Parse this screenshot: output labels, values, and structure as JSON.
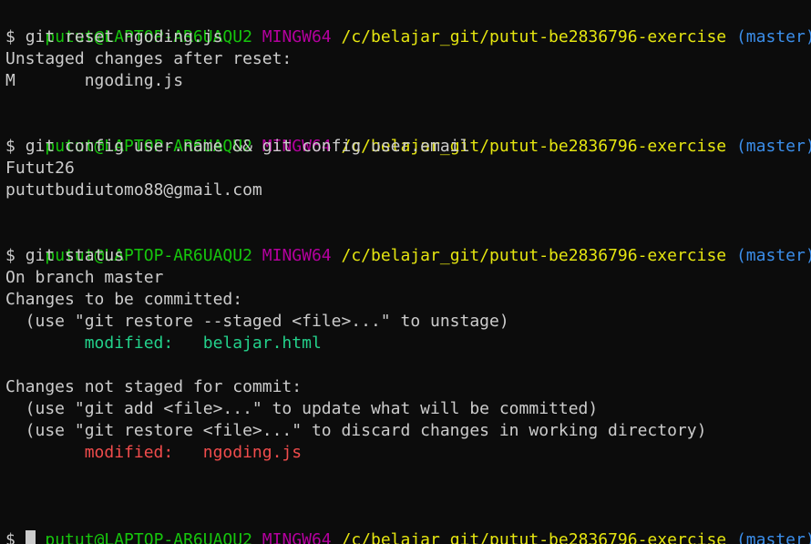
{
  "prompt": {
    "user_host": "putut@LAPTOP-AR6UAQU2",
    "system": "MINGW64",
    "path": "/c/belajar_git/putut-be2836796-exercise",
    "branch": "(master)",
    "symbol": "$"
  },
  "blocks": [
    {
      "command": "git reset ngoding.js",
      "output": [
        "Unstaged changes after reset:",
        "M       ngoding.js"
      ]
    },
    {
      "command": "git config user.name && git config user.email",
      "output": [
        "Futut26",
        "pututbudiutomo88@gmail.com"
      ]
    },
    {
      "command": "git status",
      "output_before_staged": [
        "On branch master",
        "Changes to be committed:",
        "  (use \"git restore --staged <file>...\" to unstage)"
      ],
      "staged_file": "        modified:   belajar.html",
      "output_before_unstaged": [
        "Changes not staged for commit:",
        "  (use \"git add <file>...\" to update what will be committed)",
        "  (use \"git restore <file>...\" to discard changes in working directory)"
      ],
      "unstaged_file": "        modified:   ngoding.js"
    }
  ],
  "colors": {
    "background": "#0c0c0c",
    "foreground": "#cccccc",
    "user_host": "#16c60c",
    "system": "#b4009e",
    "path": "#e5e510",
    "branch": "#3b8eea",
    "staged": "#23d18b",
    "unstaged": "#f14c4c"
  }
}
